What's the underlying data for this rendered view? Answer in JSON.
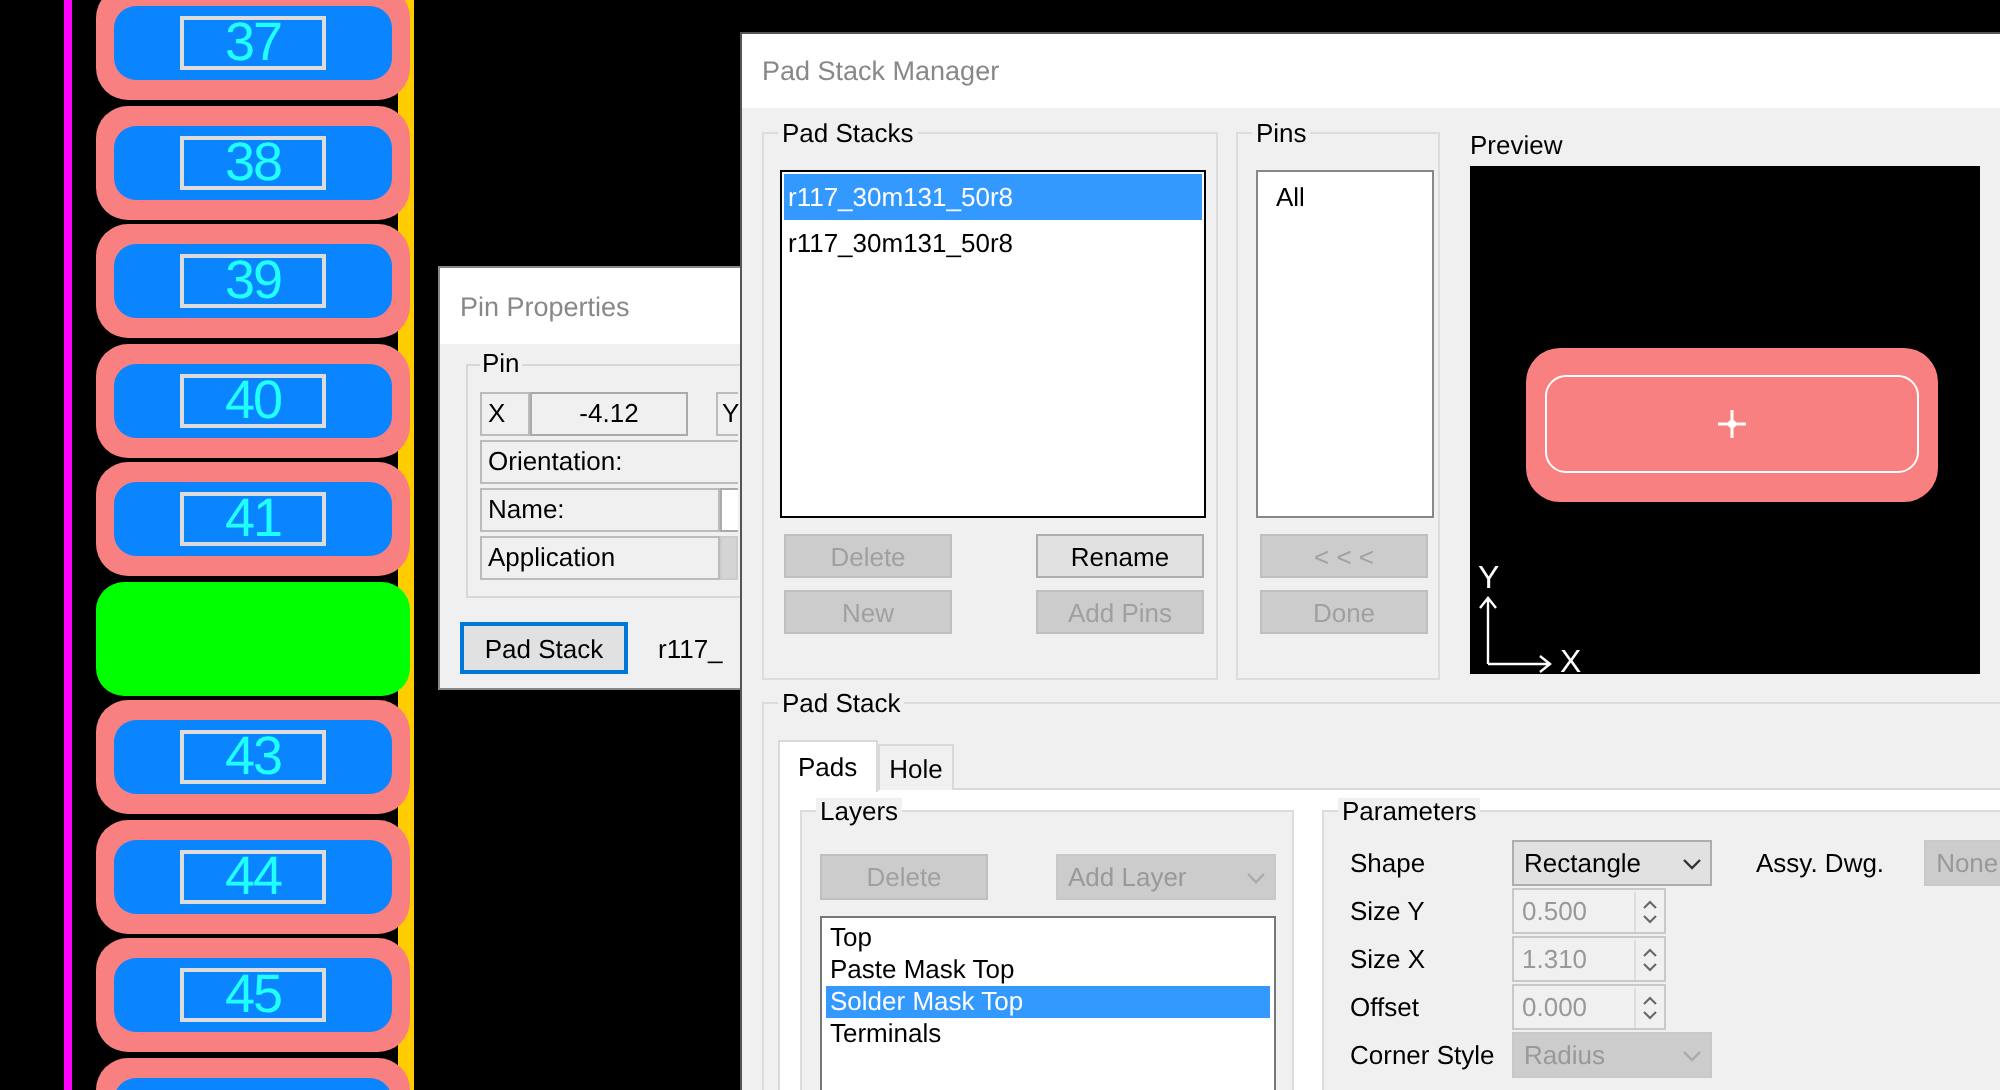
{
  "canvas": {
    "pads": [
      {
        "kind": "pad",
        "number": "37"
      },
      {
        "kind": "pad",
        "number": "38"
      },
      {
        "kind": "pad",
        "number": "39"
      },
      {
        "kind": "pad",
        "number": "40"
      },
      {
        "kind": "pad",
        "number": "41"
      },
      {
        "kind": "selected_pad"
      },
      {
        "kind": "pad",
        "number": "43"
      },
      {
        "kind": "pad",
        "number": "44"
      },
      {
        "kind": "pad",
        "number": "45"
      },
      {
        "kind": "pad"
      }
    ]
  },
  "pin_properties": {
    "title": "Pin Properties",
    "group": "Pin",
    "x_label": "X",
    "x_value": "-4.12",
    "y_label": "Y",
    "orientation_label": "Orientation:",
    "name_label": "Name:",
    "application_label": "Application",
    "pad_stack_button": "Pad Stack",
    "pad_stack_value": "r117_"
  },
  "pad_stack_manager": {
    "title": "Pad Stack Manager",
    "pad_stacks": {
      "label": "Pad Stacks",
      "items": [
        {
          "text": "r117_30m131_50r8",
          "selected": true
        },
        {
          "text": "r117_30m131_50r8",
          "selected": false
        }
      ],
      "buttons": [
        {
          "label": "Delete",
          "disabled": true
        },
        {
          "label": "Rename",
          "disabled": false
        },
        {
          "label": "New",
          "disabled": true
        },
        {
          "label": "Add Pins",
          "disabled": true
        }
      ]
    },
    "pins": {
      "label": "Pins",
      "items": [
        {
          "text": "All",
          "selected": false
        }
      ],
      "buttons": [
        {
          "label": "< < <",
          "disabled": true
        },
        {
          "label": "Done",
          "disabled": true
        }
      ]
    },
    "preview": {
      "label": "Preview",
      "axis_y": "Y",
      "axis_x": "X"
    },
    "pad_stack": {
      "label": "Pad Stack",
      "tabs": [
        {
          "label": "Pads",
          "selected": true
        },
        {
          "label": "Hole",
          "selected": false
        }
      ],
      "layers": {
        "label": "Layers",
        "delete_button": {
          "label": "Delete",
          "disabled": true
        },
        "add_layer": {
          "value": "Add Layer",
          "disabled": true
        },
        "items": [
          {
            "text": "Top",
            "selected": false
          },
          {
            "text": "Paste Mask Top",
            "selected": false
          },
          {
            "text": "Solder Mask Top",
            "selected": true
          },
          {
            "text": "Terminals",
            "selected": false
          }
        ]
      },
      "parameters": {
        "label": "Parameters",
        "fields": [
          {
            "kind": "dropdown",
            "label": "Shape",
            "value": "Rectangle",
            "disabled": false
          },
          {
            "kind": "spin",
            "label": "Size Y",
            "value": "0.500",
            "disabled": true
          },
          {
            "kind": "spin",
            "label": "Size X",
            "value": "1.310",
            "disabled": true
          },
          {
            "kind": "spin",
            "label": "Offset",
            "value": "0.000",
            "disabled": true
          },
          {
            "kind": "dropdown",
            "label": "Corner Style",
            "value": "Radius",
            "disabled": true
          }
        ],
        "assy_dwg": {
          "label": "Assy. Dwg.",
          "value": "None",
          "disabled": true
        }
      }
    }
  }
}
